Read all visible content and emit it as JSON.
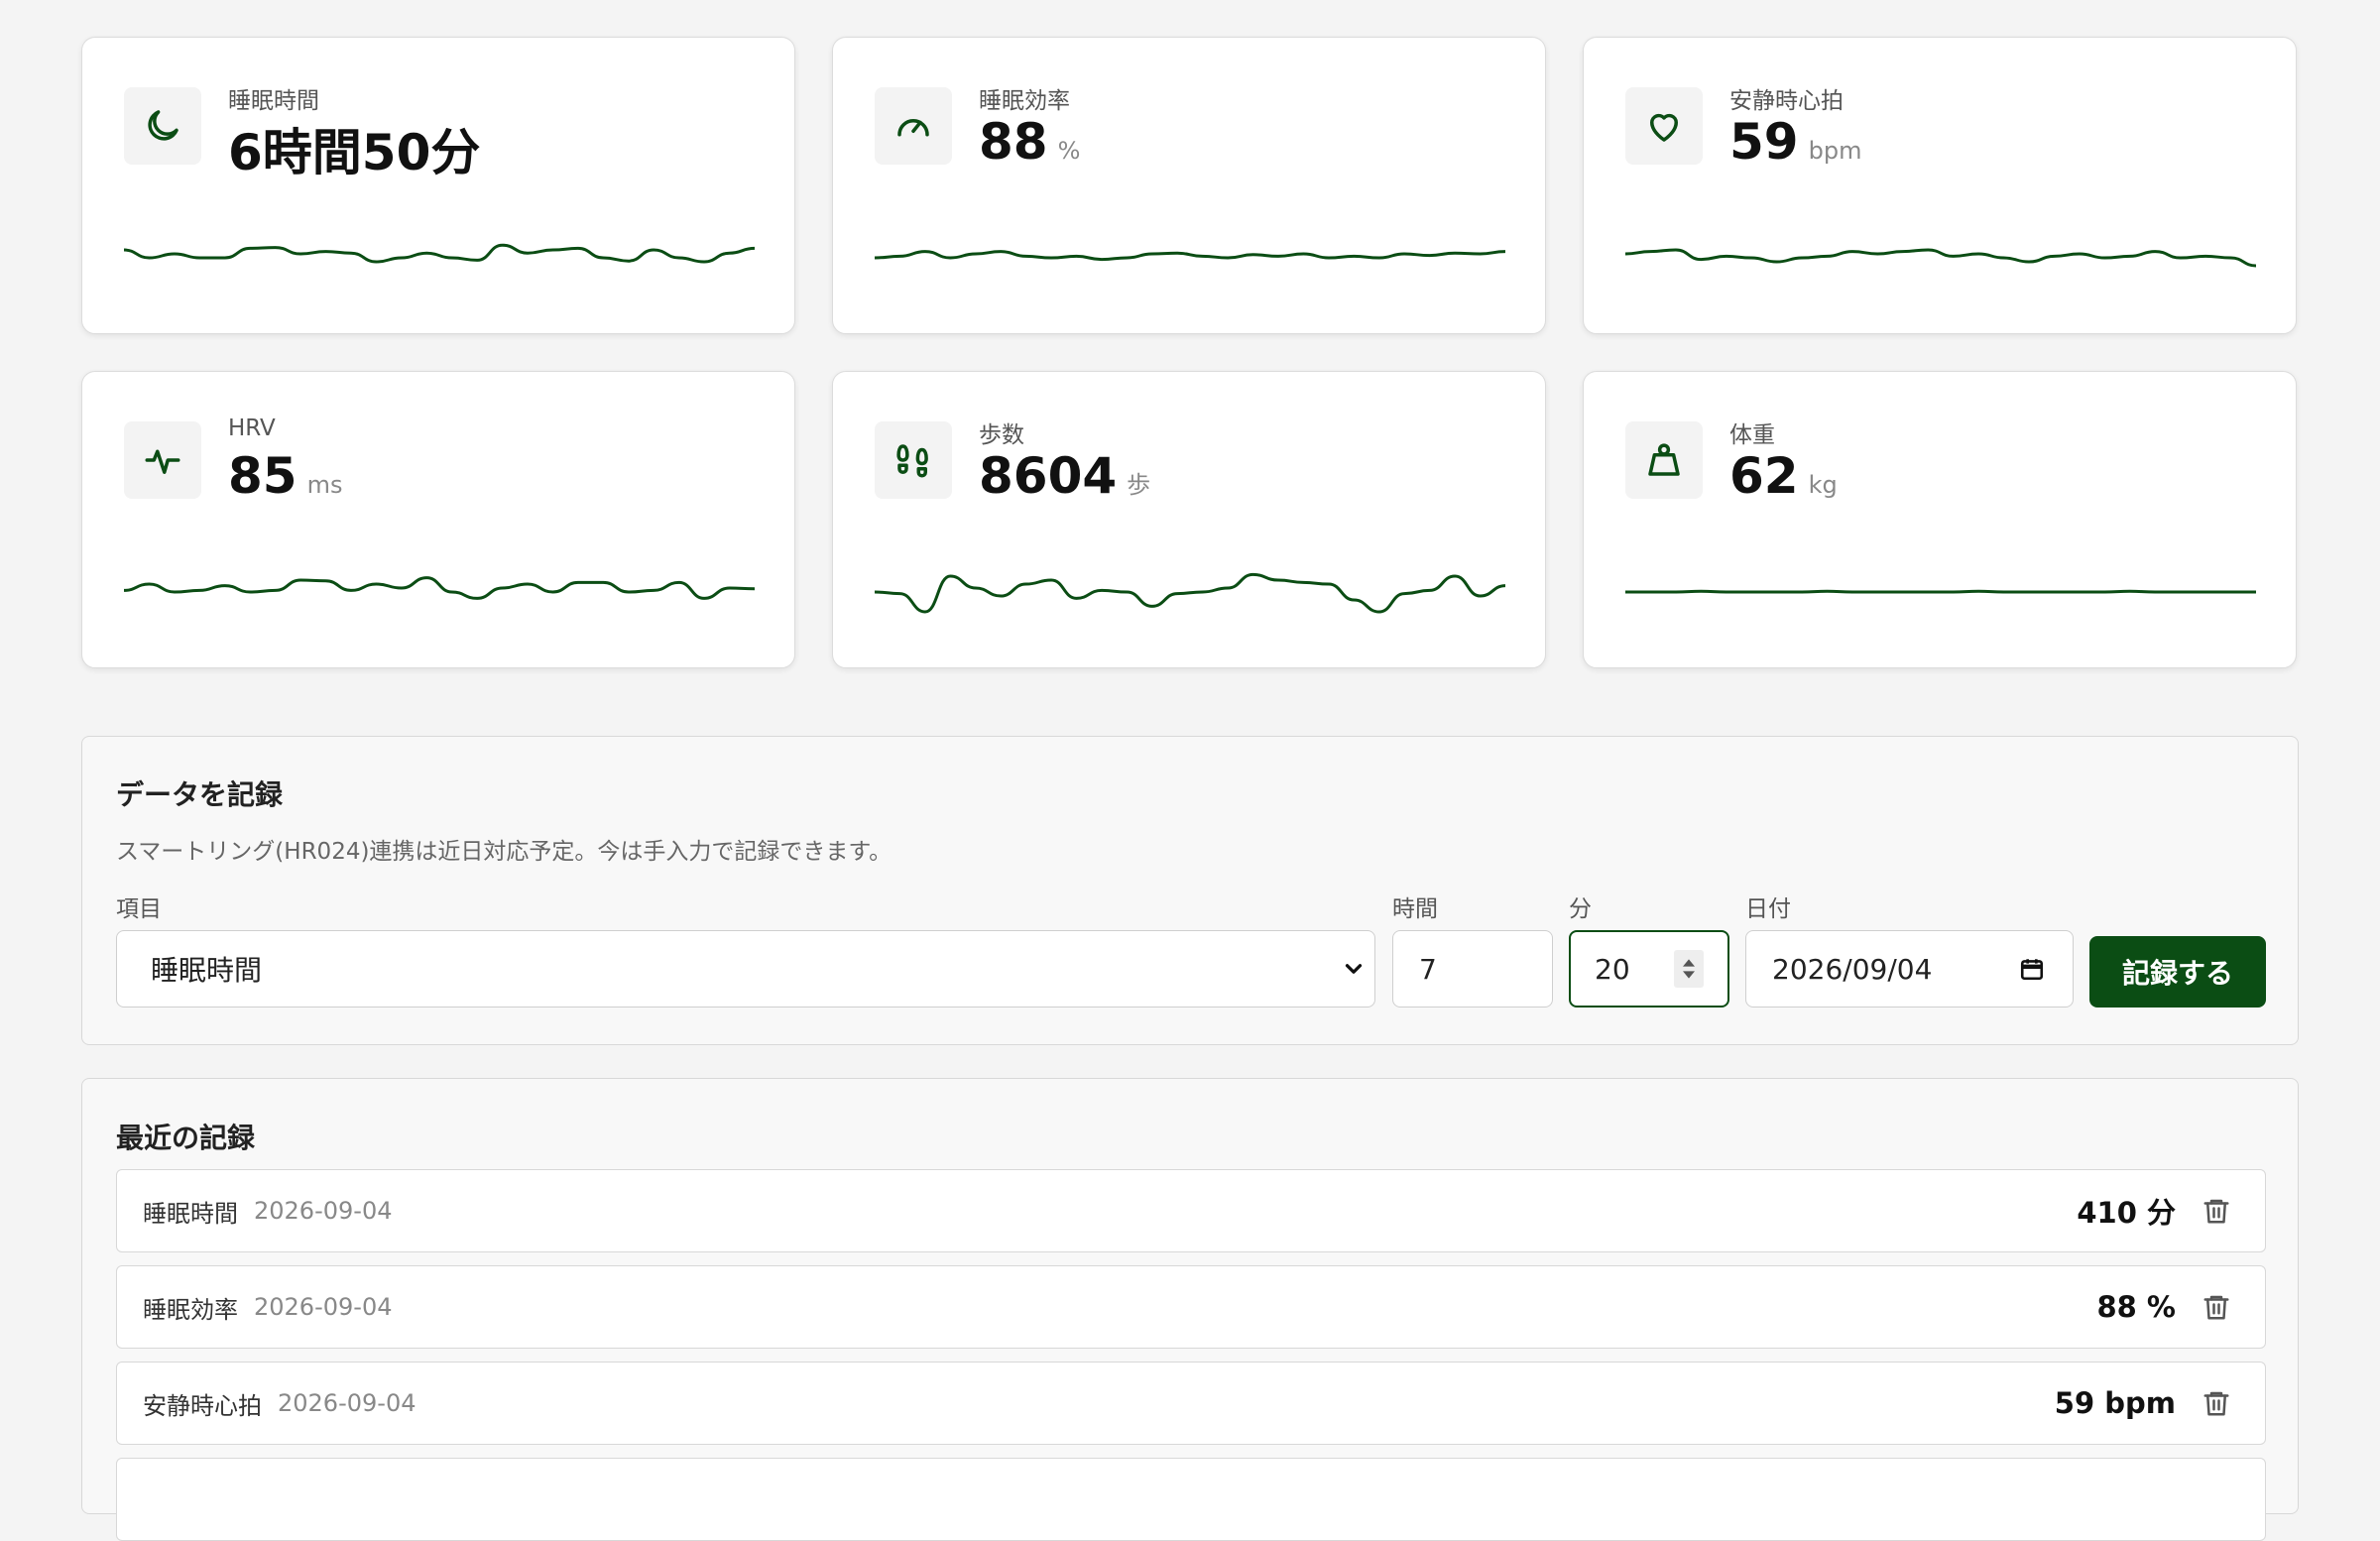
{
  "colors": {
    "accent": "#0b4d14",
    "background": "#f4f4f4"
  },
  "cards": [
    {
      "icon": "moon-icon",
      "label": "睡眠時間",
      "value": "6時間50分",
      "unit": "",
      "trend": [
        0.6,
        0.5,
        0.55,
        0.5,
        0.5,
        0.62,
        0.63,
        0.55,
        0.58,
        0.56,
        0.45,
        0.5,
        0.56,
        0.5,
        0.47,
        0.66,
        0.56,
        0.6,
        0.62,
        0.5,
        0.46,
        0.6,
        0.5,
        0.45,
        0.56,
        0.62
      ]
    },
    {
      "icon": "gauge-icon",
      "label": "睡眠効率",
      "value": "88",
      "unit": "%",
      "trend": [
        0.5,
        0.52,
        0.58,
        0.5,
        0.55,
        0.58,
        0.52,
        0.5,
        0.52,
        0.48,
        0.5,
        0.55,
        0.56,
        0.52,
        0.5,
        0.54,
        0.52,
        0.55,
        0.5,
        0.52,
        0.5,
        0.55,
        0.53,
        0.56,
        0.55,
        0.58
      ]
    },
    {
      "icon": "heart-icon",
      "label": "安静時心拍",
      "value": "59",
      "unit": "bpm",
      "trend": [
        0.55,
        0.58,
        0.6,
        0.48,
        0.52,
        0.5,
        0.45,
        0.5,
        0.52,
        0.58,
        0.55,
        0.58,
        0.6,
        0.52,
        0.55,
        0.5,
        0.45,
        0.52,
        0.55,
        0.5,
        0.52,
        0.58,
        0.5,
        0.52,
        0.5,
        0.4
      ]
    },
    {
      "icon": "activity-icon",
      "label": "HRV",
      "value": "85",
      "unit": "ms",
      "trend": [
        0.52,
        0.6,
        0.5,
        0.52,
        0.58,
        0.5,
        0.52,
        0.65,
        0.64,
        0.52,
        0.6,
        0.55,
        0.68,
        0.5,
        0.42,
        0.55,
        0.6,
        0.5,
        0.62,
        0.62,
        0.5,
        0.52,
        0.62,
        0.42,
        0.55,
        0.54
      ]
    },
    {
      "icon": "footprints-icon",
      "label": "歩数",
      "value": "8604",
      "unit": "歩",
      "trend": [
        0.5,
        0.48,
        0.25,
        0.7,
        0.55,
        0.45,
        0.6,
        0.65,
        0.42,
        0.52,
        0.5,
        0.32,
        0.48,
        0.5,
        0.55,
        0.72,
        0.65,
        0.62,
        0.6,
        0.4,
        0.25,
        0.48,
        0.52,
        0.7,
        0.45,
        0.58
      ]
    },
    {
      "icon": "weight-icon",
      "label": "体重",
      "value": "62",
      "unit": "kg",
      "trend": [
        0.5,
        0.5,
        0.5,
        0.51,
        0.5,
        0.5,
        0.5,
        0.5,
        0.51,
        0.5,
        0.5,
        0.5,
        0.5,
        0.5,
        0.51,
        0.5,
        0.5,
        0.5,
        0.5,
        0.5,
        0.51,
        0.5,
        0.5,
        0.5,
        0.5,
        0.5
      ]
    }
  ],
  "record_form": {
    "title": "データを記録",
    "note": "スマートリング(HR024)連携は近日対応予定。今は手入力で記録できます。",
    "item_label": "項目",
    "item_value": "睡眠時間",
    "hours_label": "時間",
    "hours_value": "7",
    "minutes_label": "分",
    "minutes_value": "20",
    "date_label": "日付",
    "date_value": "2026/09/04",
    "submit_label": "記録する"
  },
  "recent": {
    "title": "最近の記録",
    "rows": [
      {
        "name": "睡眠時間",
        "date": "2026-09-04",
        "value": "410 分"
      },
      {
        "name": "睡眠効率",
        "date": "2026-09-04",
        "value": "88 %"
      },
      {
        "name": "安静時心拍",
        "date": "2026-09-04",
        "value": "59 bpm"
      }
    ]
  }
}
